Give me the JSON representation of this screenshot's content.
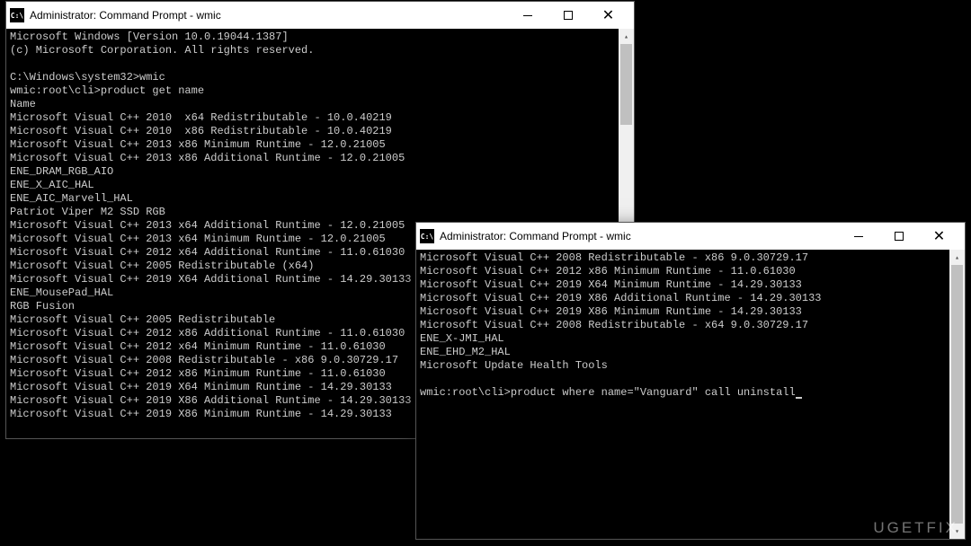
{
  "watermark": "UGETFIX",
  "window1": {
    "icon_label": "C:\\",
    "title": "Administrator: Command Prompt - wmic",
    "lines": [
      "Microsoft Windows [Version 10.0.19044.1387]",
      "(c) Microsoft Corporation. All rights reserved.",
      "",
      "C:\\Windows\\system32>wmic",
      "wmic:root\\cli>product get name",
      "Name",
      "Microsoft Visual C++ 2010  x64 Redistributable - 10.0.40219",
      "Microsoft Visual C++ 2010  x86 Redistributable - 10.0.40219",
      "Microsoft Visual C++ 2013 x86 Minimum Runtime - 12.0.21005",
      "Microsoft Visual C++ 2013 x86 Additional Runtime - 12.0.21005",
      "ENE_DRAM_RGB_AIO",
      "ENE_X_AIC_HAL",
      "ENE_AIC_Marvell_HAL",
      "Patriot Viper M2 SSD RGB",
      "Microsoft Visual C++ 2013 x64 Additional Runtime - 12.0.21005",
      "Microsoft Visual C++ 2013 x64 Minimum Runtime - 12.0.21005",
      "Microsoft Visual C++ 2012 x64 Additional Runtime - 11.0.61030",
      "Microsoft Visual C++ 2005 Redistributable (x64)",
      "Microsoft Visual C++ 2019 X64 Additional Runtime - 14.29.30133",
      "ENE_MousePad_HAL",
      "RGB Fusion",
      "Microsoft Visual C++ 2005 Redistributable",
      "Microsoft Visual C++ 2012 x86 Additional Runtime - 11.0.61030",
      "Microsoft Visual C++ 2012 x64 Minimum Runtime - 11.0.61030",
      "Microsoft Visual C++ 2008 Redistributable - x86 9.0.30729.17",
      "Microsoft Visual C++ 2012 x86 Minimum Runtime - 11.0.61030",
      "Microsoft Visual C++ 2019 X64 Minimum Runtime - 14.29.30133",
      "Microsoft Visual C++ 2019 X86 Additional Runtime - 14.29.30133",
      "Microsoft Visual C++ 2019 X86 Minimum Runtime - 14.29.30133"
    ]
  },
  "window2": {
    "icon_label": "C:\\",
    "title": "Administrator: Command Prompt - wmic",
    "lines": [
      "Microsoft Visual C++ 2008 Redistributable - x86 9.0.30729.17",
      "Microsoft Visual C++ 2012 x86 Minimum Runtime - 11.0.61030",
      "Microsoft Visual C++ 2019 X64 Minimum Runtime - 14.29.30133",
      "Microsoft Visual C++ 2019 X86 Additional Runtime - 14.29.30133",
      "Microsoft Visual C++ 2019 X86 Minimum Runtime - 14.29.30133",
      "Microsoft Visual C++ 2008 Redistributable - x64 9.0.30729.17",
      "ENE_X-JMI_HAL",
      "ENE_EHD_M2_HAL",
      "Microsoft Update Health Tools",
      "",
      "wmic:root\\cli>product where name=\"Vanguard\" call uninstall"
    ],
    "cursor": true
  }
}
